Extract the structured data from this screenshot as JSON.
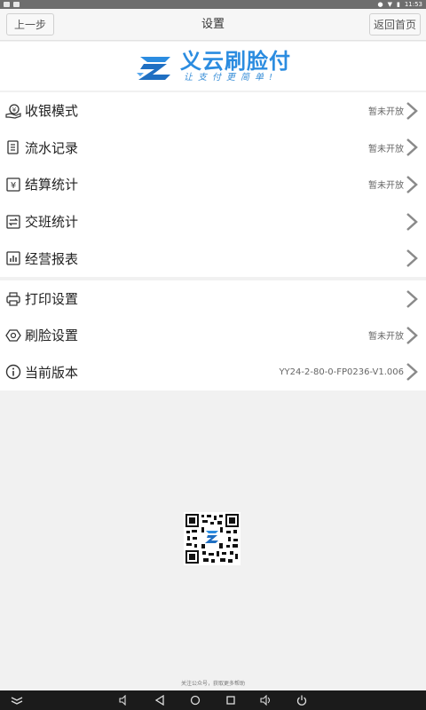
{
  "statusbar": {
    "time": "11:53"
  },
  "header": {
    "back_label": "上一步",
    "title": "设置",
    "home_label": "返回首页"
  },
  "logo": {
    "name": "义云刷脸付",
    "slogan": "让支付更简单!"
  },
  "menu_group1": [
    {
      "label": "收银模式",
      "status": "暂未开放"
    },
    {
      "label": "流水记录",
      "status": "暂未开放"
    },
    {
      "label": "结算统计",
      "status": "暂未开放"
    },
    {
      "label": "交班统计",
      "status": ""
    },
    {
      "label": "经营报表",
      "status": ""
    }
  ],
  "menu_group2": [
    {
      "label": "打印设置",
      "status": ""
    },
    {
      "label": "刷脸设置",
      "status": "暂未开放"
    },
    {
      "label": "当前版本",
      "status": "YY24-2-80-0-FP0236-V1.006"
    }
  ],
  "footer": {
    "note": "关注公众号，获取更多帮助"
  },
  "colors": {
    "brand": "#2b8ce0",
    "chevron": "#8a8a8a"
  }
}
